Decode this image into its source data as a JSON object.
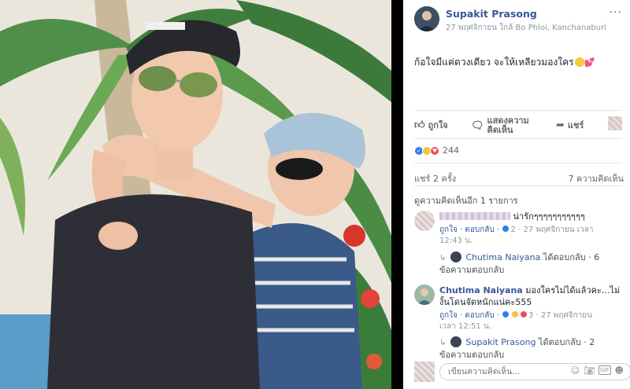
{
  "post": {
    "author": "Supakit Prasong",
    "meta": "27 พฤศจิกายน ใกล้ Bo Phloi, Kanchanaburi",
    "more": "···",
    "text": "ก้อใจมีแค่ดวงเดียว จะให้เหลียวมองใคร"
  },
  "actions": {
    "like": "ถูกใจ",
    "comment_line1": "แสดงความ",
    "comment_line2": "คิดเห็น",
    "share": "แชร์"
  },
  "stats": {
    "reaction_count": "244",
    "shares": "แชร์ 2 ครั้ง",
    "comments": "7 ความคิดเห็น",
    "view_more": "ดูความคิดเห็นอีก 1 รายการ"
  },
  "comments": [
    {
      "text": "น่ารักๆๆๆๆๆๆๆๆๆๆๆ",
      "like": "ถูกใจ",
      "reply": "ตอบกลับ",
      "reaction_count": "2",
      "time_line1": "27 พฤศจิกายน เวลา",
      "time_line2": "12:43 น.",
      "reply_author": "Chutima Naiyana",
      "reply_summary_1": "ได้ตอบกลับ · 6",
      "reply_summary_2": "ข้อความตอบกลับ"
    },
    {
      "author": "Chutima Naiyana",
      "text_line1": "มองใครไม่ได้แล้วคะ...ไม่",
      "text_line2": "งั้นโดนจัดหนักแน่คะ555",
      "like": "ถูกใจ",
      "reply": "ตอบกลับ",
      "reaction_count": "3",
      "time_line1": "27 พฤศจิกายน",
      "time_line2": "เวลา 12:51 น.",
      "reply_author": "Supakit Prasong",
      "reply_summary_1": "ได้ตอบกลับ · 2",
      "reply_summary_2": "ข้อความตอบกลับ"
    }
  ],
  "input": {
    "placeholder": "เขียนความคิดเห็น..."
  },
  "colors": {
    "link": "#365899",
    "meta": "#90949c",
    "like": "#2e80ec"
  }
}
